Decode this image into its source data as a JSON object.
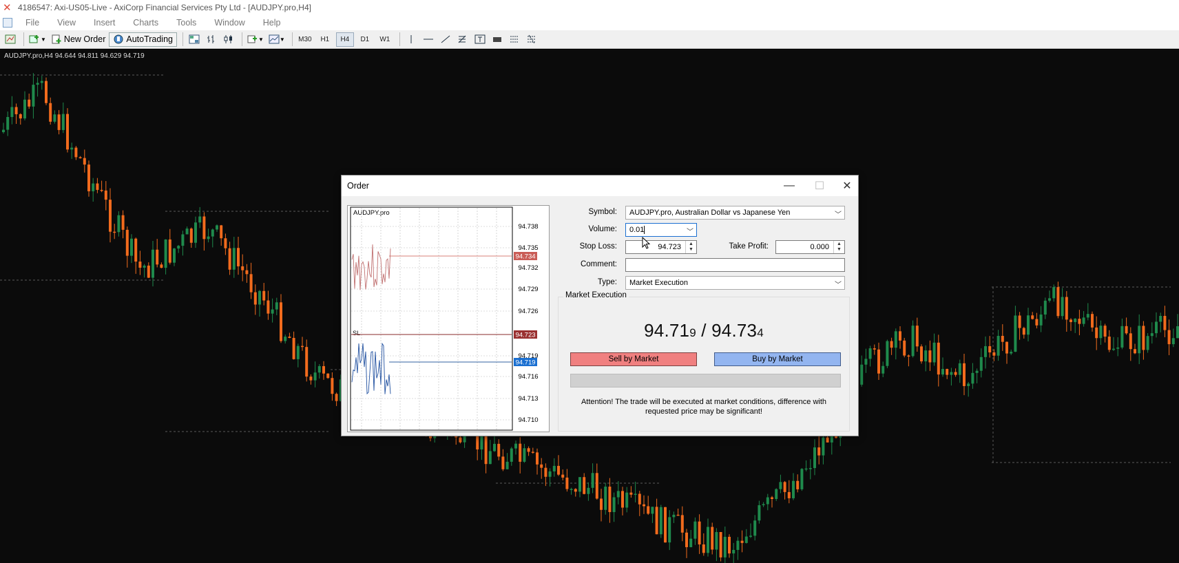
{
  "window": {
    "title": "4186547: Axi-US05-Live - AxiCorp Financial Services Pty Ltd - [AUDJPY.pro,H4]"
  },
  "menu": [
    "File",
    "View",
    "Insert",
    "Charts",
    "Tools",
    "Window",
    "Help"
  ],
  "toolbar": {
    "new_order": "New Order",
    "auto_trading": "AutoTrading",
    "timeframes": [
      "M30",
      "H1",
      "H4",
      "D1",
      "W1"
    ],
    "active_timeframe": "H4"
  },
  "chart": {
    "header": "AUDJPY.pro,H4  94.644 94.811 94.629 94.719"
  },
  "dialog": {
    "title": "Order",
    "mini_chart": {
      "symbol": "AUDJPY.pro",
      "price_labels": [
        "94.738",
        "94.735",
        "94.732",
        "94.729",
        "94.726",
        "94.719",
        "94.716",
        "94.713",
        "94.710"
      ],
      "ask_tag": "94.734",
      "sl_tag": "94.723",
      "bid_tag": "94.719",
      "sl_marker": "SL"
    },
    "symbol_label": "Symbol:",
    "symbol_value": "AUDJPY.pro, Australian Dollar vs Japanese Yen",
    "volume_label": "Volume:",
    "volume_value": "0.01",
    "stop_loss_label": "Stop Loss:",
    "stop_loss_value": "94.723",
    "take_profit_label": "Take Profit:",
    "take_profit_value": "0.000",
    "comment_label": "Comment:",
    "comment_value": "",
    "type_label": "Type:",
    "type_value": "Market Execution",
    "group_title": "Market Execution",
    "bid_main": "94.71",
    "bid_last": "9",
    "separator": " / ",
    "ask_main": "94.73",
    "ask_last": "4",
    "sell_button": "Sell by Market",
    "buy_button": "Buy by Market",
    "attention_line1": "Attention! The trade will be executed at market conditions, difference with",
    "attention_line2": "requested price may be significant!"
  },
  "colors": {
    "bull": "#1f8a4c",
    "bear": "#f26b1d",
    "sell_btn": "#f08080",
    "buy_btn": "#93b5f0",
    "arrow": "#e02020"
  }
}
